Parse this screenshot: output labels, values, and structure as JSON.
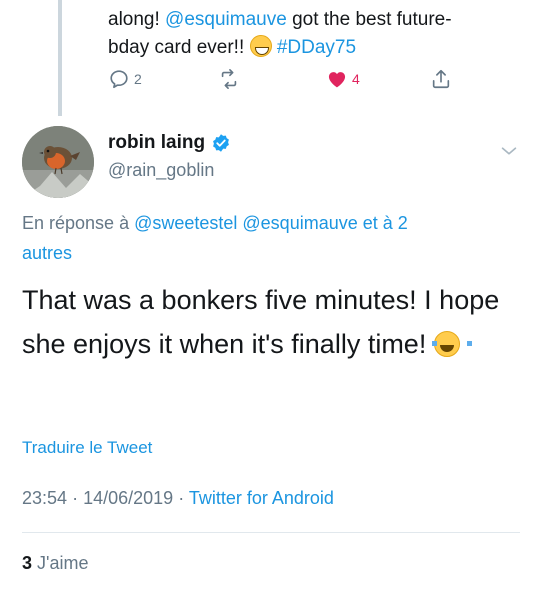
{
  "previous_tweet": {
    "line1_prefix": "along! ",
    "mention": "@esquimauve",
    "line1_suffix": " got the best future-",
    "line2_prefix": "bday card ever!! ",
    "hashtag": "#DDay75",
    "emoji_icon": "grinning-face-emoji",
    "actions": {
      "reply_count": "2",
      "retweet_count": "",
      "like_count": "4"
    }
  },
  "tweet": {
    "author_name": "robin laing",
    "author_handle": "@rain_goblin",
    "verified": true,
    "reply_to_prefix": "En réponse à ",
    "reply_to_mentions": "@sweetestel @esquimauve",
    "reply_to_suffix": " et à 2",
    "reply_to_more": "autres",
    "text": "That was a bonkers five minutes! I hope she enjoys it when it's finally time!",
    "text_emoji_icon": "face-with-tears-of-joy-emoji",
    "translate_label": "Traduire le Tweet",
    "time": "23:54",
    "date": "14/06/2019",
    "source": "Twitter for Android",
    "separator": "·",
    "likes_count": "3",
    "likes_label": "J'aime"
  },
  "colors": {
    "link_blue": "#1b95e0",
    "muted": "#657786",
    "like_red": "#e0245e",
    "text": "#14171a"
  }
}
